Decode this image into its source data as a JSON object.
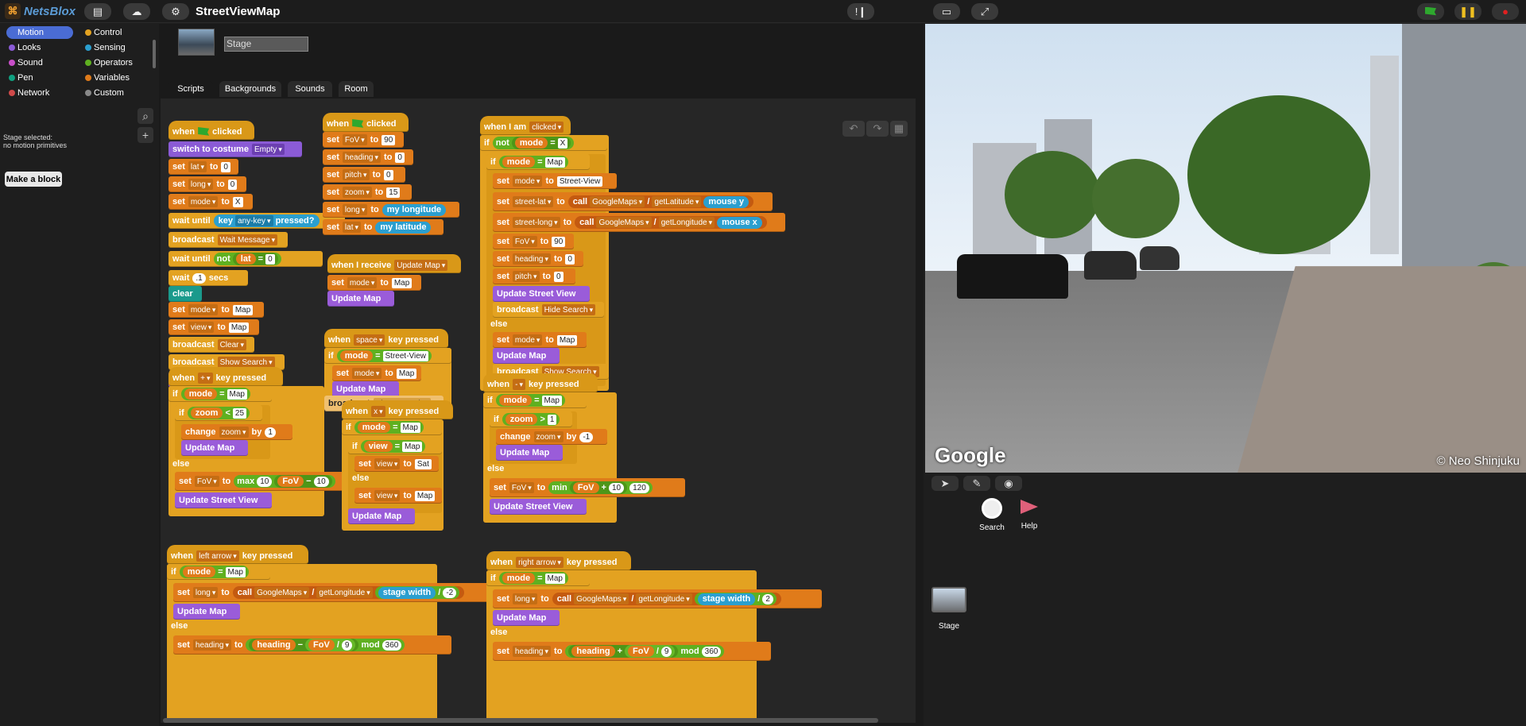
{
  "app": {
    "name": "NetsBlox",
    "project_title": "StreetViewMap"
  },
  "palette": {
    "categories": [
      {
        "label": "Motion",
        "color": "#4a6cd4"
      },
      {
        "label": "Control",
        "color": "#e3a221"
      },
      {
        "label": "Looks",
        "color": "#8b5bd6"
      },
      {
        "label": "Sensing",
        "color": "#2b9fcf"
      },
      {
        "label": "Sound",
        "color": "#c94fc9"
      },
      {
        "label": "Operators",
        "color": "#5fb020"
      },
      {
        "label": "Pen",
        "color": "#10a080"
      },
      {
        "label": "Variables",
        "color": "#e07b1a"
      },
      {
        "label": "Network",
        "color": "#d04a4a"
      },
      {
        "label": "Custom",
        "color": "#888888"
      }
    ],
    "status_line1": "Stage selected:",
    "status_line2": "no motion primitives",
    "make_block": "Make a block"
  },
  "sprite": {
    "name": "Stage"
  },
  "tabs": [
    "Scripts",
    "Backgrounds",
    "Sounds",
    "Room"
  ],
  "scripts": {
    "s1": {
      "hat": "when",
      "clicked": "clicked",
      "switch": "switch to costume",
      "empty": "Empty",
      "set": "set",
      "to": "to",
      "lat": "lat",
      "long": "long",
      "mode": "mode",
      "zero": "0",
      "X": "X",
      "wait_until": "wait until",
      "key": "key",
      "anykey": "any-key",
      "pressed": "pressed?",
      "broadcast": "broadcast",
      "wait_msg": "Wait Message",
      "not": "not",
      "eq": "=",
      "wait": "wait",
      "dot1": ".1",
      "secs": "secs",
      "clear": "clear",
      "Map": "Map",
      "view": "view",
      "Clear": "Clear",
      "show_search": "Show Search",
      "update_map": "Update Map"
    },
    "s2": {
      "FoV": "FoV",
      "v90": "90",
      "heading": "heading",
      "pitch": "pitch",
      "zoom": "zoom",
      "v15": "15",
      "my_long": "my longitude",
      "my_lat": "my latitude"
    },
    "s3": {
      "when_receive": "when I receive",
      "update_map": "Update Map"
    },
    "s4": {
      "space": "space",
      "key_pressed": "key pressed",
      "if": "if",
      "street": "Street-View"
    },
    "s5": {
      "when_i_am": "when I am",
      "clicked": "clicked",
      "hide_search": "Hide Search",
      "else": "else",
      "street_lat": "street-lat",
      "street_long": "street-long",
      "call": "call",
      "gmaps": "GoogleMaps",
      "getlat": "getLatitude",
      "getlong": "getLongitude",
      "mouse_y": "mouse y",
      "mouse_x": "mouse x",
      "slash": "/",
      "update_sv": "Update Street View"
    },
    "s6": {
      "plus": "+",
      "lt": "<",
      "v25": "25",
      "change": "change",
      "by": "by",
      "one": "1",
      "max": "max",
      "v10": "10",
      "minus": "−",
      "neg10": "-10"
    },
    "s7": {
      "xkey": "x",
      "sat": "Sat"
    },
    "s8": {
      "minuskey": "-",
      "gt": ">",
      "neg1": "-1",
      "min": "min",
      "plus": "+",
      "v120": "120"
    },
    "s9": {
      "left_arrow": "left arrow",
      "stage_width": "stage width",
      "neg2": "-2",
      "nine": "9",
      "mod": "mod",
      "v360": "360"
    },
    "s10": {
      "right_arrow": "right arrow",
      "two": "2"
    }
  },
  "stage": {
    "watermark": "Google",
    "copyright": "© Neo Shinjuku"
  },
  "corral": {
    "search": "Search",
    "help": "Help",
    "stage": "Stage"
  },
  "colors": {
    "accent": "#4a6cd4",
    "event": "#d99818",
    "motion": "#e07b1a",
    "looks": "#8b5bd6",
    "operators": "#5fb020",
    "sensing": "#2b9fcf"
  }
}
